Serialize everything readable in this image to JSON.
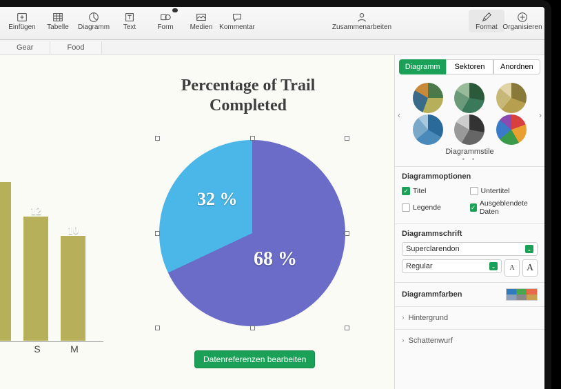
{
  "toolbar": {
    "insert": "Einfügen",
    "table": "Tabelle",
    "chart": "Diagramm",
    "text": "Text",
    "shape": "Form",
    "media": "Medien",
    "comment": "Kommentar",
    "collab": "Zusammenarbeiten",
    "format": "Format",
    "organize": "Organisieren"
  },
  "tabs": {
    "gear": "Gear",
    "food": "Food"
  },
  "chart_title": "Percentage of Trail Completed",
  "edit_button": "Datenreferenzen bearbeiten",
  "bar_fragment": {
    "values": [
      "",
      "12",
      "10"
    ],
    "labels": [
      "",
      "S",
      "M"
    ]
  },
  "chart_data": {
    "type": "pie",
    "title": "Percentage of Trail Completed",
    "slices": [
      {
        "label": "",
        "value": 68,
        "display": "68 %",
        "color": "#6a6cc8"
      },
      {
        "label": "",
        "value": 32,
        "display": "32 %",
        "color": "#4ab7e8"
      }
    ]
  },
  "sidebar": {
    "segments": {
      "chart": "Diagramm",
      "sectors": "Sektoren",
      "arrange": "Anordnen"
    },
    "styles_label": "Diagrammstile",
    "options_title": "Diagrammoptionen",
    "opt_title": "Titel",
    "opt_subtitle": "Untertitel",
    "opt_legend": "Legende",
    "opt_hidden": "Ausgeblendete Daten",
    "font_title": "Diagrammschrift",
    "font_family": "Superclarendon",
    "font_weight": "Regular",
    "small_a": "A",
    "big_a": "A",
    "colors_title": "Diagrammfarben",
    "background": "Hintergrund",
    "shadow": "Schattenwurf"
  }
}
